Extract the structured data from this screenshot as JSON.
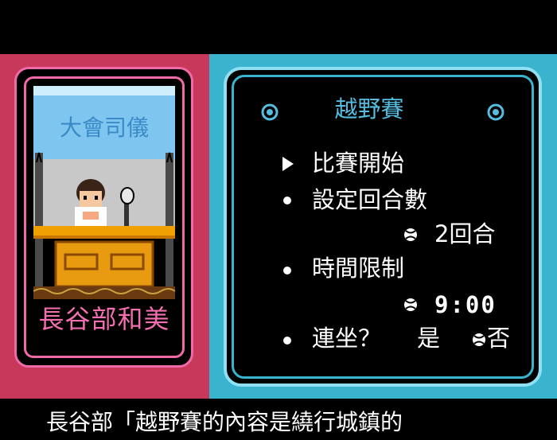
{
  "host": {
    "name": "長谷部和美",
    "sign": "大會司儀"
  },
  "menu": {
    "title": "越野賽",
    "items": [
      {
        "label": "比賽開始"
      },
      {
        "label": "設定回合數",
        "value": "2回合"
      },
      {
        "label": "時間限制",
        "value": "9:00"
      },
      {
        "label": "連坐？",
        "opt_yes": "是",
        "opt_no": "否"
      }
    ]
  },
  "dialog": {
    "text": "長谷部「越野賽的內容是繞行城鎮的"
  },
  "colors": {
    "accent_pink": "#f06aa8",
    "accent_cyan": "#3ab4ce",
    "panel_left": "#c8385a"
  },
  "icons": [
    "target-icon",
    "cursor-arrow-icon",
    "bullet-icon",
    "ball-icon"
  ]
}
